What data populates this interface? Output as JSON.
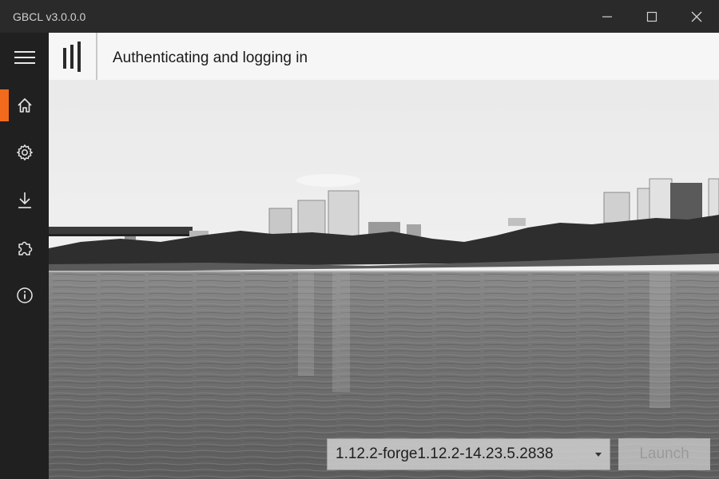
{
  "window": {
    "title": "GBCL v3.0.0.0",
    "controls": [
      "minimize-icon",
      "maximize-icon",
      "close-icon"
    ]
  },
  "sidebar": {
    "items": [
      {
        "icon": "hamburger-menu-icon",
        "active": false
      },
      {
        "icon": "home-icon",
        "active": true
      },
      {
        "icon": "gear-icon",
        "active": false
      },
      {
        "icon": "download-icon",
        "active": false
      },
      {
        "icon": "puzzle-icon",
        "active": false
      },
      {
        "icon": "info-icon",
        "active": false
      }
    ],
    "accent_color": "#f26a1b"
  },
  "header": {
    "status": "Authenticating and logging in"
  },
  "footer": {
    "version_selected": "1.12.2-forge1.12.2-14.23.5.2838",
    "launch_label": "Launch"
  }
}
